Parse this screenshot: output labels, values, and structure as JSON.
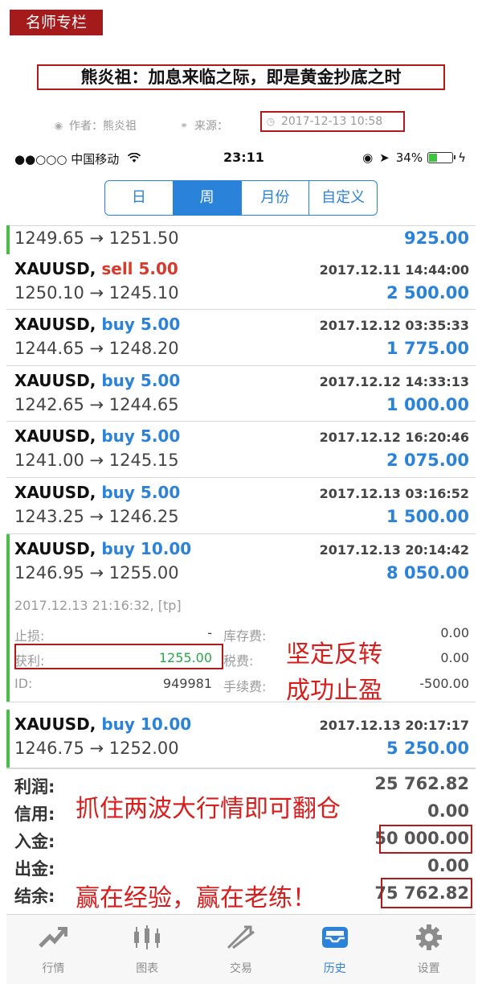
{
  "article": {
    "column_tag": "名师专栏",
    "title": "熊炎祖：加息来临之际，即是黄金抄底之时",
    "author": "作者：熊炎祖",
    "source": "来源：",
    "date": "2017-12-13 10:58"
  },
  "status": {
    "carrier": "●●○○○ 中国移动",
    "time": "23:11",
    "battery": "34%",
    "battery_level": 0.34
  },
  "period_tabs": [
    "日",
    "周",
    "月份",
    "自定义"
  ],
  "period_tabs_active": "周",
  "first_row": {
    "prices": "1249.65 → 1251.50",
    "profit": "925.00"
  },
  "trades": [
    {
      "symbol": "XAUUSD,",
      "side": "sell",
      "volume": "5.00",
      "time": "2017.12.11 14:44:00",
      "prices": "1250.10 → 1245.10",
      "profit": "2 500.00"
    },
    {
      "symbol": "XAUUSD,",
      "side": "buy",
      "volume": "5.00",
      "time": "2017.12.12 03:35:33",
      "prices": "1244.65 → 1248.20",
      "profit": "1 775.00"
    },
    {
      "symbol": "XAUUSD,",
      "side": "buy",
      "volume": "5.00",
      "time": "2017.12.12 14:33:13",
      "prices": "1242.65 → 1244.65",
      "profit": "1 000.00"
    },
    {
      "symbol": "XAUUSD,",
      "side": "buy",
      "volume": "5.00",
      "time": "2017.12.12 16:20:46",
      "prices": "1241.00 → 1245.15",
      "profit": "2 075.00"
    },
    {
      "symbol": "XAUUSD,",
      "side": "buy",
      "volume": "5.00",
      "time": "2017.12.13 03:16:52",
      "prices": "1243.25 → 1246.25",
      "profit": "1 500.00"
    },
    {
      "symbol": "XAUUSD,",
      "side": "buy",
      "volume": "10.00",
      "time": "2017.12.13 20:14:42",
      "prices": "1246.95 → 1255.00",
      "profit": "8 050.00"
    },
    {
      "symbol": "XAUUSD,",
      "side": "buy",
      "volume": "10.00",
      "time": "2017.12.13 20:17:17",
      "prices": "1246.75 → 1252.00",
      "profit": "5 250.00"
    }
  ],
  "detail": {
    "close_info": "2017.12.13 21:16:32, [tp]",
    "sl_label": "止损:",
    "sl_value": "-",
    "tp_label": "获利:",
    "tp_value": "1255.00",
    "id_label": "ID:",
    "id_value": "949981",
    "swap_label": "库存费:",
    "swap_value": "0.00",
    "tax_label": "税费:",
    "tax_value": "0.00",
    "fee_label": "手续费:",
    "fee_value": "-500.00"
  },
  "annotations": {
    "firm_reversal": "坚定反转",
    "take_profit": "成功止盈",
    "waves": "抓住两波大行情即可翻仓",
    "slogan": "赢在经验，赢在老练！"
  },
  "summary": {
    "profit_label": "利润:",
    "profit_value": "25 762.82",
    "credit_label": "信用:",
    "credit_value": "0.00",
    "deposit_label": "入金:",
    "deposit_value": "50 000.00",
    "withdraw_label": "出金:",
    "withdraw_value": "0.00",
    "balance_label": "结余:",
    "balance_value": "75 762.82"
  },
  "tabbar": [
    {
      "label": "行情",
      "icon": "quotes-icon"
    },
    {
      "label": "图表",
      "icon": "chart-icon"
    },
    {
      "label": "交易",
      "icon": "trade-icon"
    },
    {
      "label": "历史",
      "icon": "history-icon"
    },
    {
      "label": "设置",
      "icon": "settings-icon"
    }
  ],
  "tabbar_active": "历史",
  "colors": {
    "accent": "#2b82d9",
    "sell": "#d93a2b",
    "annotation": "#d81d1d",
    "frame": "#b11a1a",
    "profit_green": "#2aa84a"
  }
}
